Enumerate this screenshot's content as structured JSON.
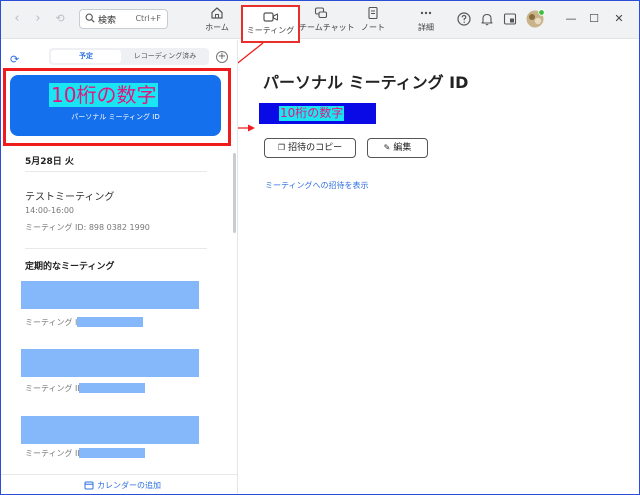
{
  "titlebar": {
    "nav_back": "‹",
    "nav_forward": "›",
    "history": "⟲",
    "search": {
      "label": "検索",
      "shortcut": "Ctrl+F"
    },
    "tabs": [
      {
        "id": "home",
        "label": "ホーム",
        "icon": "home-icon"
      },
      {
        "id": "meeting",
        "label": "ミーティング",
        "icon": "video-icon",
        "active": true
      },
      {
        "id": "team-chat",
        "label": "チームチャット",
        "icon": "chat-icon"
      },
      {
        "id": "notes",
        "label": "ノート",
        "icon": "note-icon"
      },
      {
        "id": "more",
        "label": "詳細",
        "icon": "more-icon"
      }
    ],
    "window": {
      "minimize": "—",
      "maximize": "☐",
      "close": "✕"
    }
  },
  "left": {
    "segment": {
      "upcoming": "予定",
      "recorded": "レコーディング済み"
    },
    "pmi": {
      "number": "10桁の数字",
      "subtitle": "パーソナル ミーティング ID"
    },
    "date_heading": "5月28日 火",
    "meeting": {
      "title": "テストミーティング",
      "time": "14:00-16:00",
      "id_line": "ミーティング ID: 898 0382 1990"
    },
    "recurring_heading": "定期的なミーティング",
    "recurring_items": [
      {
        "id_label": "ミーティング ID:"
      },
      {
        "id_label": "ミーティング ID:"
      },
      {
        "id_label": "ミーティング ID:"
      }
    ],
    "footer": {
      "add_calendar": "カレンダーの追加"
    }
  },
  "right": {
    "title": "パーソナル ミーティング ID",
    "id_value": "10桁の数字",
    "copy_invite": "招待のコピー",
    "edit": "編集",
    "show_invite_link": "ミーティングへの招待を表示"
  },
  "colors": {
    "accent": "#2d6fe0",
    "card_blue": "#1570ee",
    "highlight_cyan": "#19e6f2",
    "highlight_text": "#e2167e",
    "annotation_red": "#ee1c1c",
    "redaction_blue": "#85b7fb",
    "id_box_blue": "#0a0ae6"
  }
}
